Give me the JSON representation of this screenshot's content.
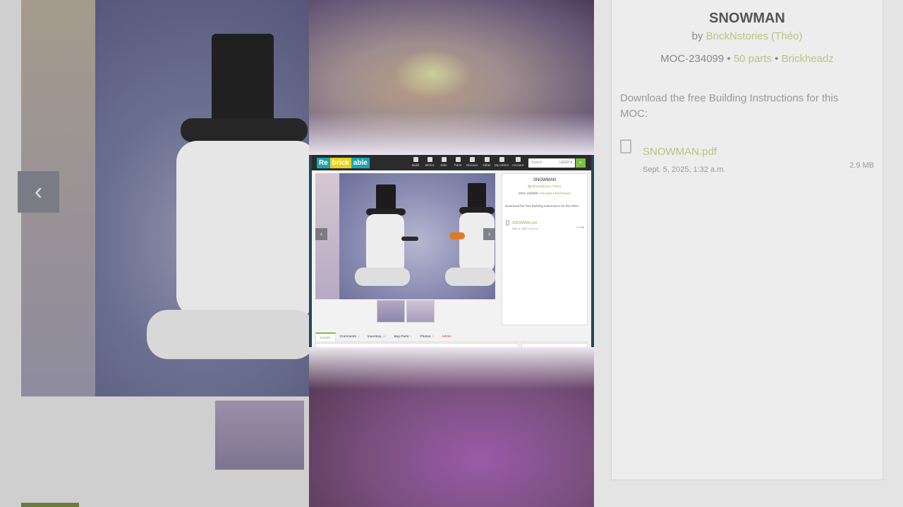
{
  "background_right": {
    "title": "SNOWMAN",
    "by_prefix": "by",
    "author": "BrickNstories (Théo)",
    "moc_id": "MOC-234099",
    "parts": "50 parts",
    "theme": "Brickheadz",
    "download_text": "Download the free Building Instructions for this MOC:",
    "file_name": "SNOWMAN.pdf",
    "file_date": "Sept. 5, 2025, 1:32 a.m.",
    "file_size": "2.9 MB"
  },
  "background_left": {
    "prev_arrow": "‹"
  },
  "site": {
    "logo": {
      "part1": "Re",
      "part2": "brick",
      "part3": "able"
    },
    "nav": [
      {
        "label": "Build",
        "icon": "hammer-icon"
      },
      {
        "label": "MOCs",
        "icon": "rocket-icon"
      },
      {
        "label": "Sets",
        "icon": "cube-icon"
      },
      {
        "label": "Parts",
        "icon": "bricks-icon"
      },
      {
        "label": "Discuss",
        "icon": "chat-icon"
      },
      {
        "label": "Other",
        "icon": "document-icon"
      },
      {
        "label": "My LEGO",
        "icon": "briefcase-icon"
      },
      {
        "label": "Account",
        "icon": "user-icon"
      }
    ],
    "search_placeholder": "Search",
    "search_scope": "LEGO ▾",
    "search_button": "⌕",
    "gallery": {
      "prev": "‹",
      "next": "›"
    },
    "info": {
      "title": "SNOWMAN",
      "by_prefix": "by",
      "author": "BrickNstories (Théo)",
      "moc_id": "MOC-234099",
      "parts": "50 parts",
      "theme": "Brickheadz",
      "download_text": "Download the free Building Instructions for this MOC:",
      "file_name": "SNOWMAN.pdf",
      "file_date": "Sept. 5, 2025, 1:32 a.m.",
      "file_size": "2.9 MB"
    },
    "tabs": [
      {
        "label": "Details",
        "count": ""
      },
      {
        "label": "Comments",
        "count": "0"
      },
      {
        "label": "Inventory",
        "count": "10"
      },
      {
        "label": "Buy Parts",
        "count": "1"
      },
      {
        "label": "Photos",
        "count": "0"
      },
      {
        "label": "Admin",
        "count": ""
      }
    ]
  }
}
